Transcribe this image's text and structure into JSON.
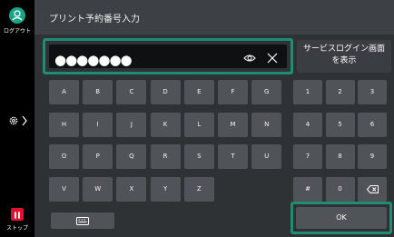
{
  "sidebar": {
    "logout_label": "ログアウト",
    "stop_label": "ストップ"
  },
  "header": {
    "title": "プリント予約番号入力"
  },
  "pin_input": {
    "masked_value": "●●●●●●●"
  },
  "service_login": {
    "line1": "サービスログイン画面",
    "line2": "を表示"
  },
  "keys": {
    "row1": [
      "A",
      "B",
      "C",
      "D",
      "E",
      "F",
      "G"
    ],
    "row2": [
      "H",
      "I",
      "J",
      "K",
      "L",
      "M",
      "N"
    ],
    "row3": [
      "O",
      "P",
      "Q",
      "R",
      "S",
      "T",
      "U"
    ],
    "row4": [
      "V",
      "W",
      "X",
      "Y",
      "Z"
    ],
    "numpad": [
      "1",
      "2",
      "3",
      "4",
      "5",
      "6",
      "7",
      "8",
      "9",
      "#",
      "0"
    ]
  },
  "ok_label": "OK",
  "colors": {
    "accent": "#1f8d74",
    "stop": "#e01030"
  },
  "icons": [
    "user-logout-icon",
    "gear-icon",
    "chevron-right-icon",
    "stop-icon",
    "eye-icon",
    "clear-icon",
    "keyboard-icon",
    "backspace-icon"
  ]
}
